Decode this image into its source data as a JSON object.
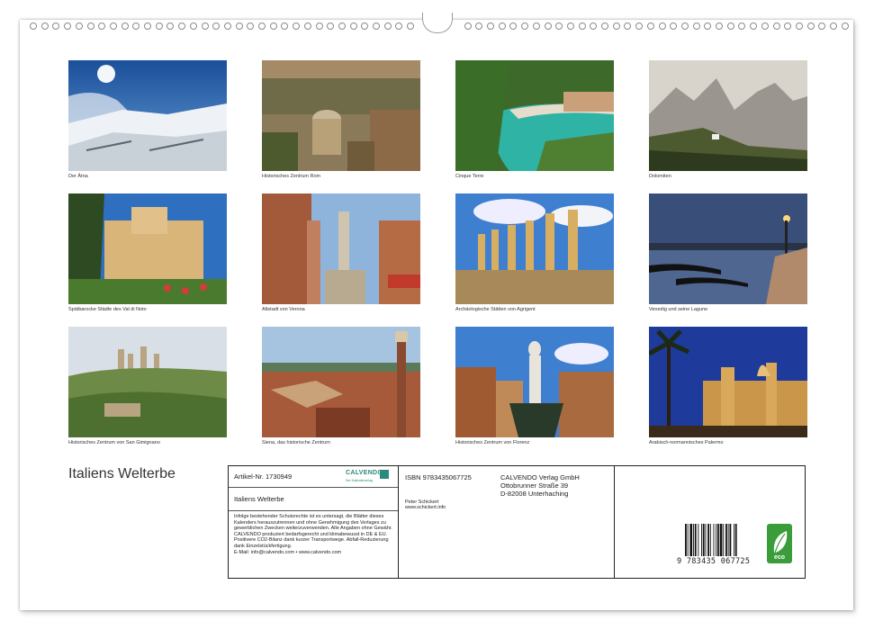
{
  "title": "Italiens Welterbe",
  "photos": [
    {
      "caption": "Der Ätna"
    },
    {
      "caption": "Historisches Zentrum Rom"
    },
    {
      "caption": "Cinque Terre"
    },
    {
      "caption": "Dolomiten"
    },
    {
      "caption": "Spätbarocke Städte des Val di Noto"
    },
    {
      "caption": "Altstadt von Verona"
    },
    {
      "caption": "Archäologische Stätten von Agrigent"
    },
    {
      "caption": "Venedig und seine Lagune"
    },
    {
      "caption": "Historisches Zentrum von San Gimignano"
    },
    {
      "caption": "Siena, das historische Zentrum"
    },
    {
      "caption": "Historisches Zentrum von Florenz"
    },
    {
      "caption": "Arabisch-normannisches Palermo"
    }
  ],
  "info": {
    "article_no": "Artikel-Nr. 1730949",
    "logo": "CALVENDO",
    "logo_sub": "Der Kalenderverlag",
    "product_title": "Italiens Welterbe",
    "legal_text": "Infolge bestehender Schutzrechte ist es untersagt, die Blätter dieses Kalenders herauszutrennen und ohne Genehmigung des Verlages zu gewerblichen Zwecken weiterzuverwenden. Alle Angaben ohne Gewähr. CALVENDO produziert bedarfsgerecht und klimabewusst in DE & EU. Positivere CO2-Bilanz dank kurzer Transportwege. Abfall-Reduzierung dank Einzelstückfertigung.",
    "contact": "E-Mail: info@calvendo.com • www.calvendo.com",
    "isbn": "ISBN 9783435067725",
    "author": "Peter Schickert",
    "author_web": "www.schickert.info",
    "publisher_name": "CALVENDO Verlag GmbH",
    "publisher_street": "Ottobrunner Straße 39",
    "publisher_city": "D-82008 Unterhaching",
    "ean_digits": "9 783435 067725",
    "eco_label": "eco"
  }
}
